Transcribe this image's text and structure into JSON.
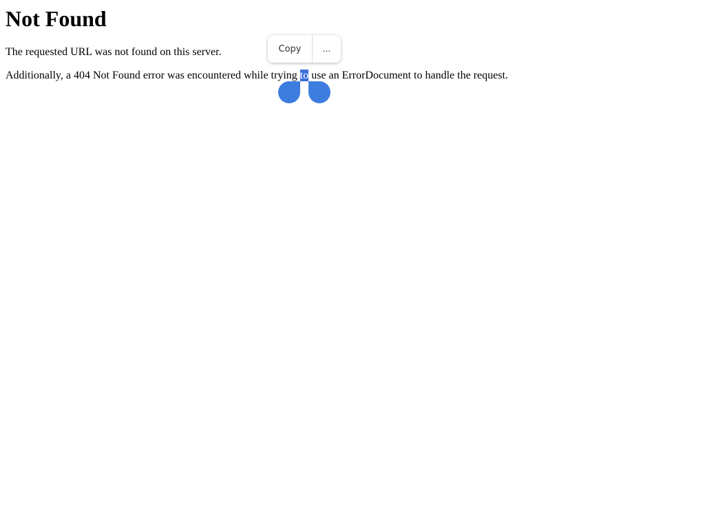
{
  "page": {
    "title": "Not Found",
    "message": "The requested URL was not found on this server.",
    "additional": {
      "before": "Additionally, a 404 Not Found error was encountered while trying ",
      "selected": "to",
      "after": " use an ErrorDocument to handle the request."
    }
  },
  "selection_toolbar": {
    "copy_label": "Copy",
    "more_label": "..."
  },
  "colors": {
    "selection": "#3a6fd8",
    "handle": "#3d7ddf"
  }
}
